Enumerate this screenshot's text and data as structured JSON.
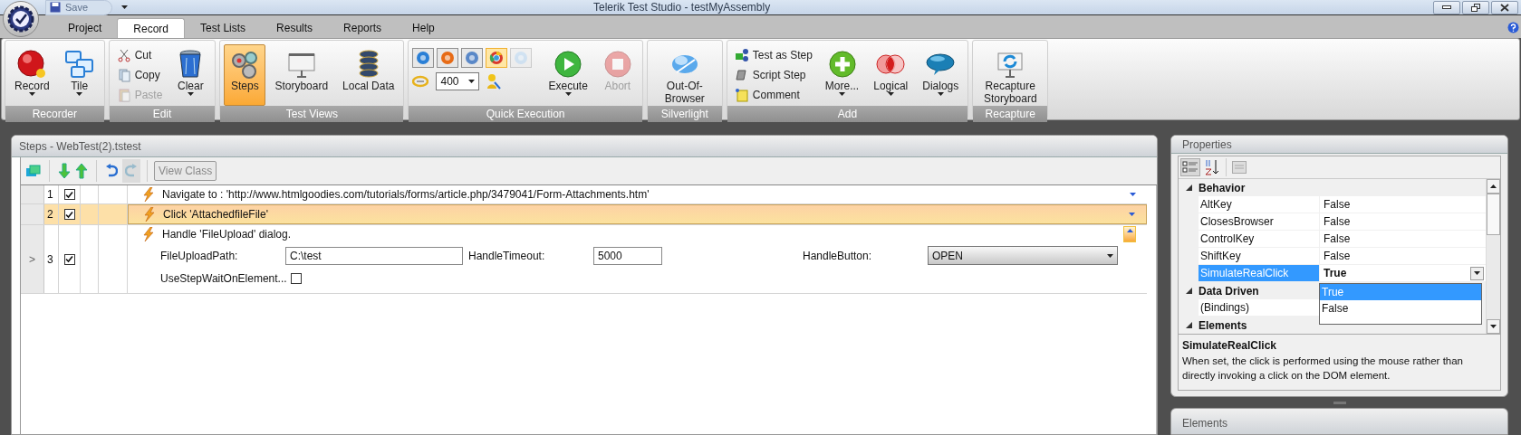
{
  "window": {
    "title": "Telerik Test Studio - testMyAssembly",
    "quick_access": [
      {
        "label": "Save",
        "disabled": true
      }
    ]
  },
  "tabs": [
    {
      "label": "Project",
      "selected": false
    },
    {
      "label": "Record",
      "selected": true
    },
    {
      "label": "Test Lists",
      "selected": false
    },
    {
      "label": "Results",
      "selected": false
    },
    {
      "label": "Reports",
      "selected": false
    },
    {
      "label": "Help",
      "selected": false
    }
  ],
  "ribbon_groups": [
    {
      "label": "Recorder",
      "items": [
        {
          "kind": "large",
          "label": "Record",
          "dropdown": true
        },
        {
          "kind": "large",
          "label": "Tile",
          "dropdown": true
        }
      ]
    },
    {
      "label": "Edit",
      "items": [
        {
          "kind": "small",
          "label": "Cut",
          "disabled": false
        },
        {
          "kind": "small",
          "label": "Copy",
          "disabled": false
        },
        {
          "kind": "small",
          "label": "Paste",
          "disabled": true
        },
        {
          "kind": "large",
          "label": "Clear",
          "dropdown": true
        }
      ]
    },
    {
      "label": "Test Views",
      "items": [
        {
          "kind": "large",
          "label": "Steps",
          "selected": true
        },
        {
          "kind": "large",
          "label": "Storyboard",
          "selected": false
        },
        {
          "kind": "large",
          "label": "Local Data",
          "selected": false
        }
      ]
    },
    {
      "label": "Quick Execution",
      "items": [
        {
          "kind": "browser",
          "selected": false,
          "disabled": false
        },
        {
          "kind": "browser",
          "selected": false,
          "disabled": false
        },
        {
          "kind": "browser",
          "selected": false,
          "disabled": false
        },
        {
          "kind": "browser",
          "selected": true,
          "disabled": false
        },
        {
          "kind": "browser",
          "selected": false,
          "disabled": true
        },
        {
          "kind": "speed",
          "value": "400"
        },
        {
          "kind": "large",
          "label": "Execute",
          "dropdown": true,
          "disabled": false
        },
        {
          "kind": "large",
          "label": "Abort",
          "disabled": true
        }
      ]
    },
    {
      "label": "Silverlight",
      "items": [
        {
          "kind": "large",
          "label": "Out-Of-Browser"
        }
      ]
    },
    {
      "label": "Add",
      "items": [
        {
          "kind": "small",
          "label": "Test as Step",
          "disabled": false
        },
        {
          "kind": "small",
          "label": "Script Step",
          "disabled": false
        },
        {
          "kind": "small",
          "label": "Comment",
          "disabled": false
        },
        {
          "kind": "large",
          "label": "More...",
          "dropdown": true
        },
        {
          "kind": "large",
          "label": "Logical",
          "dropdown": true
        },
        {
          "kind": "large",
          "label": "Dialogs",
          "dropdown": true
        }
      ]
    },
    {
      "label": "Recapture",
      "items": [
        {
          "kind": "large",
          "label": "Recapture Storyboard"
        }
      ]
    }
  ],
  "steps_panel": {
    "title": "Steps - WebTest(2).tstest",
    "view_class_button": {
      "label": "View Class",
      "disabled": true
    },
    "rows": [
      {
        "number": "1",
        "checked": true,
        "selected": false,
        "expanded": false,
        "description": "Navigate to : 'http://www.htmlgoodies.com/tutorials/forms/article.php/3479041/Form-Attachments.htm'"
      },
      {
        "number": "2",
        "checked": true,
        "selected": true,
        "expanded": false,
        "description": "Click 'AttachedfileFile'"
      },
      {
        "number": "3",
        "checked": true,
        "selected": false,
        "expanded": true,
        "gutter_mark": ">",
        "description": "Handle 'FileUpload' dialog.",
        "fields": [
          {
            "kind": "text",
            "label": "FileUploadPath:",
            "value": "C:\\test"
          },
          {
            "kind": "text",
            "label": "HandleTimeout:",
            "value": "5000"
          },
          {
            "kind": "select",
            "label": "HandleButton:",
            "value": "OPEN"
          },
          {
            "kind": "checkbox",
            "label": "UseStepWaitOnElement...",
            "checked": false
          }
        ]
      }
    ]
  },
  "properties_panel": {
    "title": "Properties",
    "categories": [
      {
        "label": "Behavior",
        "expanded": true,
        "rows": [
          {
            "name": "AltKey",
            "value": "False",
            "selected": false
          },
          {
            "name": "ClosesBrowser",
            "value": "False",
            "selected": false
          },
          {
            "name": "ControlKey",
            "value": "False",
            "selected": false
          },
          {
            "name": "ShiftKey",
            "value": "False",
            "selected": false
          },
          {
            "name": "SimulateRealClick",
            "value": "True",
            "selected": true
          }
        ]
      },
      {
        "label": "Data Driven",
        "expanded": true,
        "rows": [
          {
            "name": "(Bindings)",
            "selected": false
          }
        ]
      },
      {
        "label": "Elements",
        "expanded": true
      }
    ],
    "dropdown_options": [
      {
        "label": "True",
        "selected": true
      },
      {
        "label": "False",
        "selected": false
      }
    ],
    "description": {
      "title": "SimulateRealClick",
      "text": "When set, the click is performed using the mouse rather than directly invoking a click on the DOM element."
    }
  },
  "elements_panel": {
    "title": "Elements"
  }
}
